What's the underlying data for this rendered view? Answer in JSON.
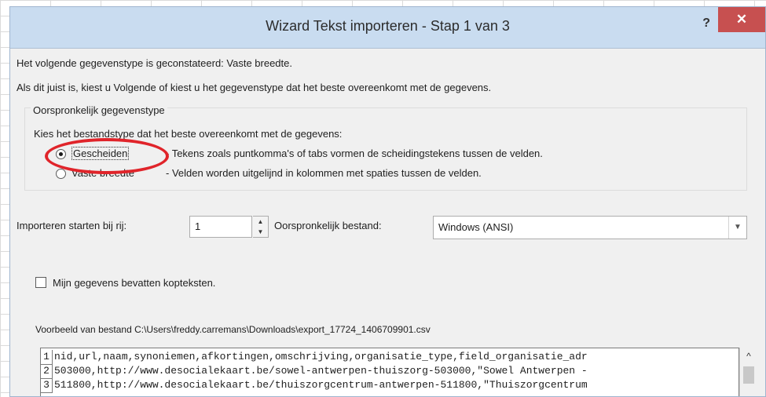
{
  "window": {
    "title": "Wizard Tekst importeren - Stap 1 van 3",
    "help_label": "?",
    "close_label": "✕"
  },
  "intro": {
    "detected": "Het volgende gegevenstype is geconstateerd: Vaste breedte.",
    "instruction": "Als dit juist is, kiest u Volgende of kiest u het gegevenstype dat het beste overeenkomt met de gegevens."
  },
  "original_type": {
    "group_label": "Oorspronkelijk gegevenstype",
    "prompt": "Kies het bestandstype dat het beste overeenkomt met de gegevens:",
    "options": [
      {
        "label": "Gescheiden",
        "description": "- Tekens zoals puntkomma's of tabs vormen de scheidingstekens tussen de velden.",
        "selected": true
      },
      {
        "label": "Vaste breedte",
        "description": "- Velden worden uitgelijnd in kolommen met spaties tussen de velden.",
        "selected": false
      }
    ]
  },
  "import_start": {
    "label": "Importeren starten bij rij:",
    "value": "1"
  },
  "file_origin": {
    "label": "Oorspronkelijk bestand:",
    "value": "Windows (ANSI)"
  },
  "headers_checkbox": {
    "label": "Mijn gegevens bevatten kopteksten.",
    "checked": false
  },
  "preview": {
    "label": "Voorbeeld van bestand C:\\Users\\freddy.carremans\\Downloads\\export_17724_1406709901.csv",
    "lines": [
      {
        "num": "1",
        "text": "nid,url,naam,synoniemen,afkortingen,omschrijving,organisatie_type,field_organisatie_adr"
      },
      {
        "num": "2",
        "text": "503000,http://www.desocialekaart.be/sowel-antwerpen-thuiszorg-503000,\"Sowel Antwerpen -"
      },
      {
        "num": "3",
        "text": "511800,http://www.desocialekaart.be/thuiszorgcentrum-antwerpen-511800,\"Thuiszorgcentrum"
      }
    ]
  },
  "icons": {
    "radio_selected": "radio-selected-icon",
    "spin": "spin-up-down-icon",
    "dropdown": "chevron-down-icon",
    "scroll_up": "scroll-up-icon"
  },
  "colors": {
    "titlebar": "#c9dcf0",
    "close_button": "#c75050",
    "highlight_ellipse": "#e0242a",
    "dialog_bg": "#f0f0f0"
  }
}
